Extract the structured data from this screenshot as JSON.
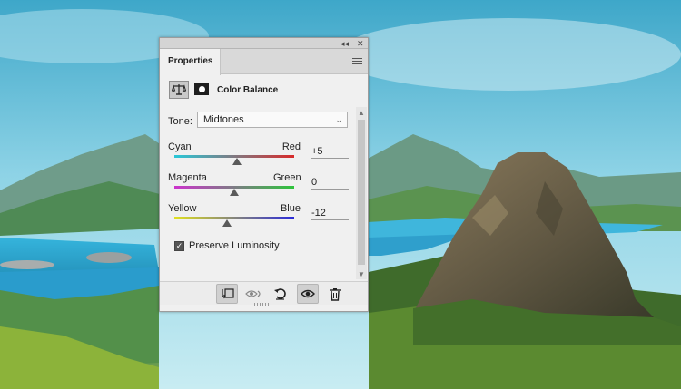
{
  "panel": {
    "tab": "Properties",
    "title": "Color Balance",
    "tone": {
      "label": "Tone:",
      "value": "Midtones"
    },
    "sliders": [
      {
        "left": "Cyan",
        "right": "Red",
        "value": "+5",
        "level": 5,
        "colors": [
          "#29c8d8",
          "#d82a2a"
        ]
      },
      {
        "left": "Magenta",
        "right": "Green",
        "value": "0",
        "level": 0,
        "colors": [
          "#cc33cc",
          "#2ec43c"
        ]
      },
      {
        "left": "Yellow",
        "right": "Blue",
        "value": "-12",
        "level": -12,
        "colors": [
          "#e0e020",
          "#2a2ad8"
        ]
      }
    ],
    "preserve_luminosity": {
      "label": "Preserve Luminosity",
      "checked": true
    },
    "scroll": {
      "up": "▲",
      "down": "▼"
    }
  },
  "icons": {
    "collapse": "double-chevron-left-icon",
    "close": "close-icon",
    "adjustment": "scales-icon",
    "mask": "layer-mask-icon",
    "clip": "clip-to-layer-icon",
    "view_previous": "view-previous-state-icon",
    "reset": "reset-icon",
    "visibility": "eye-icon",
    "delete": "trash-icon"
  }
}
